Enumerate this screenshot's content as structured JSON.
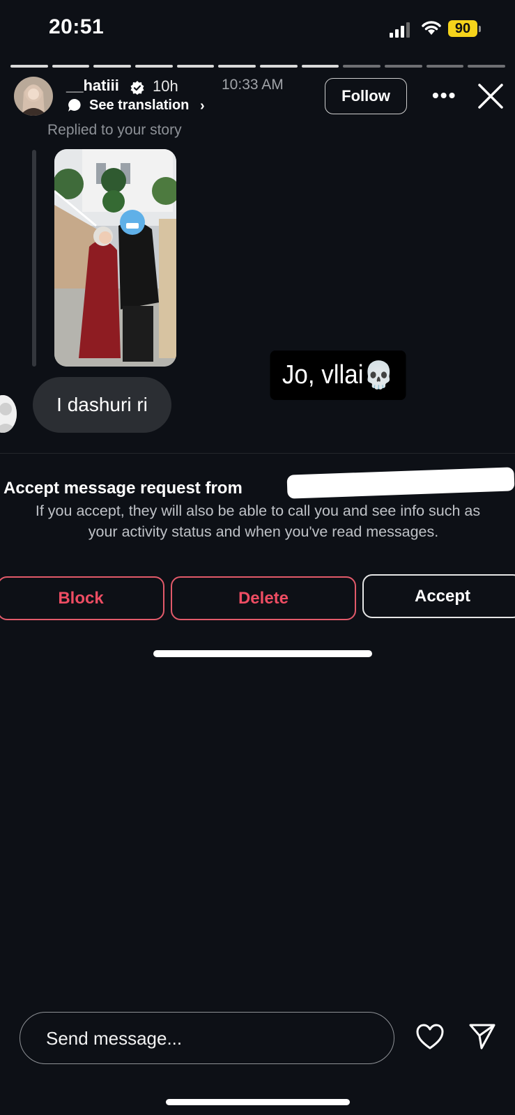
{
  "status_bar": {
    "time": "20:51",
    "battery": "90"
  },
  "story": {
    "segments_total": 12,
    "segments_done": 8
  },
  "header": {
    "username": "__hatiii",
    "age": "10h",
    "timestamp": "10:33 AM",
    "translation_label": "See translation",
    "follow_label": "Follow",
    "more_icon": "more-dots-icon",
    "close_icon": "close-icon"
  },
  "thread": {
    "replied_label": "Replied to your story",
    "message": "I dashuri ri",
    "sticker_text": "Jo, vllai",
    "sticker_emoji": "💀"
  },
  "request": {
    "title": "Accept message request from",
    "body_line1": "If you accept, they will also be able to call you and see info such as",
    "body_line2": "your activity status and when you've read messages.",
    "block_label": "Block",
    "delete_label": "Delete",
    "accept_label": "Accept"
  },
  "composer": {
    "placeholder": "Send message..."
  },
  "colors": {
    "background": "#0d1016",
    "danger": "#ee4d63",
    "battery": "#f5d31b"
  }
}
